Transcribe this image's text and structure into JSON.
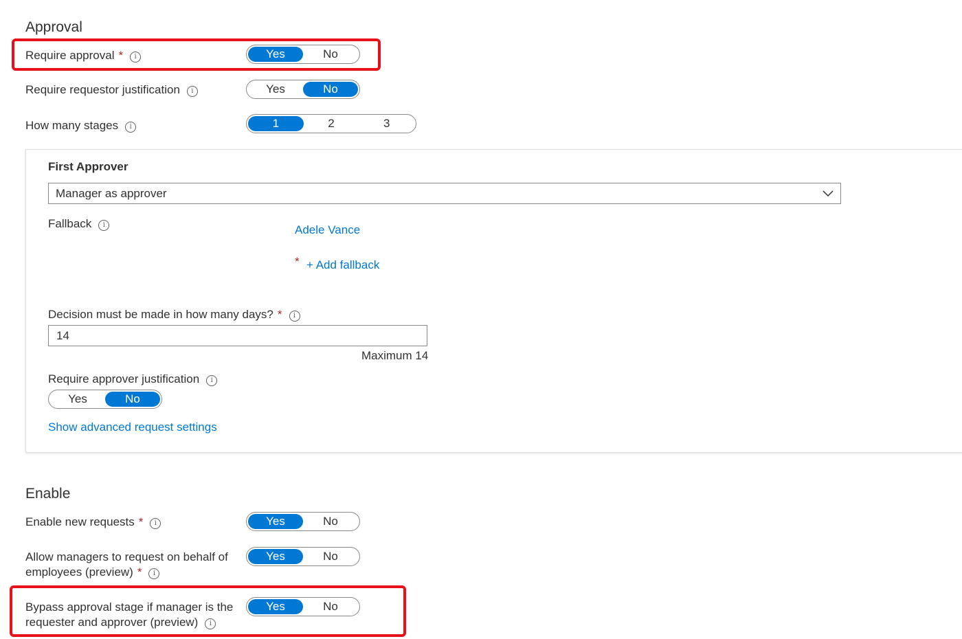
{
  "approval": {
    "title": "Approval",
    "require_approval": {
      "label": "Require approval",
      "required": "*",
      "info": "i",
      "options": [
        "Yes",
        "No"
      ],
      "selected": "Yes"
    },
    "require_requestor_justification": {
      "label": "Require requestor justification",
      "info": "i",
      "options": [
        "Yes",
        "No"
      ],
      "selected": "No"
    },
    "how_many_stages": {
      "label": "How many stages",
      "info": "i",
      "options": [
        "1",
        "2",
        "3"
      ],
      "selected": "1"
    }
  },
  "first_approver": {
    "title": "First Approver",
    "dropdown_value": "Manager as approver",
    "fallback_label": "Fallback",
    "fallback_info": "i",
    "fallback_user": "Adele Vance",
    "add_fallback_required": "*",
    "add_fallback": "+ Add fallback",
    "decision_label": "Decision must be made in how many days?",
    "decision_required": "*",
    "decision_info": "i",
    "decision_value": "14",
    "decision_hint": "Maximum 14",
    "approver_justification": {
      "label": "Require approver justification",
      "info": "i",
      "options": [
        "Yes",
        "No"
      ],
      "selected": "No"
    },
    "advanced_link": "Show advanced request settings"
  },
  "enable": {
    "title": "Enable",
    "enable_new_requests": {
      "label": "Enable new requests",
      "required": "*",
      "info": "i",
      "options": [
        "Yes",
        "No"
      ],
      "selected": "Yes"
    },
    "allow_managers": {
      "label_line1": "Allow managers to request on behalf of",
      "label_line2": "employees (preview)",
      "required": "*",
      "info": "i",
      "options": [
        "Yes",
        "No"
      ],
      "selected": "Yes"
    },
    "bypass_approval": {
      "label_line1": "Bypass approval stage if manager is the",
      "label_line2": "requester and approver (preview)",
      "info": "i",
      "options": [
        "Yes",
        "No"
      ],
      "selected": "Yes"
    }
  },
  "colors": {
    "accent": "#0078d4",
    "highlight": "#e8111a",
    "required": "#a4262c"
  },
  "icons": {
    "info": "info-icon",
    "chevron": "chevron-down-icon"
  }
}
